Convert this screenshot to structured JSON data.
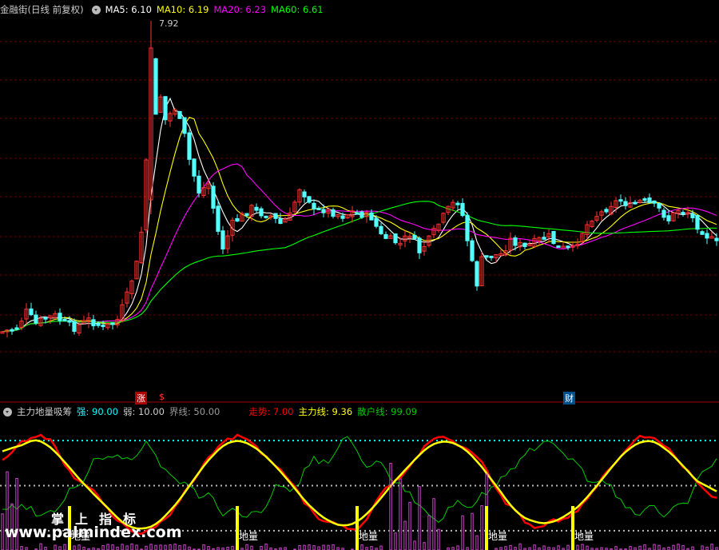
{
  "upper_header": {
    "title": "金融街(日线 前复权)",
    "ma5_label": "MA5: 6.10",
    "ma10_label": "MA10: 6.19",
    "ma20_label": "MA20: 6.23",
    "ma60_label": "MA60: 6.61",
    "colors": {
      "title": "#cccccc",
      "ma5": "#ffffff",
      "ma10": "#ffff00",
      "ma20": "#ff00ff",
      "ma60": "#00ff00"
    }
  },
  "annotations": {
    "high_price": "7.92",
    "zhang_marker": "涨",
    "dollar_marker": "$",
    "cai_marker": "财"
  },
  "lower_header": {
    "title": "主力地量吸筹",
    "strong_label": "强: 90.00",
    "weak_label": "弱: 10.00",
    "boundary_label": "界线: 50.00",
    "trend_label": "走势: 7.00",
    "main_force_label": "主力线: 9.36",
    "retail_label": "散户线: 99.09"
  },
  "signal_label": "地量",
  "watermark": {
    "cn": "掌上指标",
    "url": "www.palmindex.com"
  },
  "colors": {
    "up": "#ff3232",
    "down": "#54ffff",
    "ma5": "#ffffff",
    "ma10": "#ffff00",
    "ma20": "#ff00ff",
    "ma60": "#00ff00",
    "grid": "#8b0000",
    "trend": "#ff0000",
    "main_force": "#ffff00",
    "retail": "#00cc00",
    "dotted": "#bbbbbb",
    "dotted_top": "#00ffff",
    "volume_bar": "#cc44cc",
    "signal_bar": "#ffff00"
  },
  "chart_data": [
    {
      "type": "candlestick",
      "title": "金融街(日线 前复权)",
      "annotated_high": 7.92,
      "series_legend": [
        {
          "name": "MA5",
          "last": 6.1
        },
        {
          "name": "MA10",
          "last": 6.19
        },
        {
          "name": "MA20",
          "last": 6.23
        },
        {
          "name": "MA60",
          "last": 6.61
        }
      ]
    },
    {
      "type": "line",
      "title": "主力地量吸筹",
      "levels": {
        "strong": 90.0,
        "weak": 10.0,
        "boundary": 50.0
      },
      "series": [
        {
          "name": "走势",
          "last": 7.0
        },
        {
          "name": "主力线",
          "last": 9.36
        },
        {
          "name": "散户线",
          "last": 99.09
        }
      ]
    }
  ]
}
